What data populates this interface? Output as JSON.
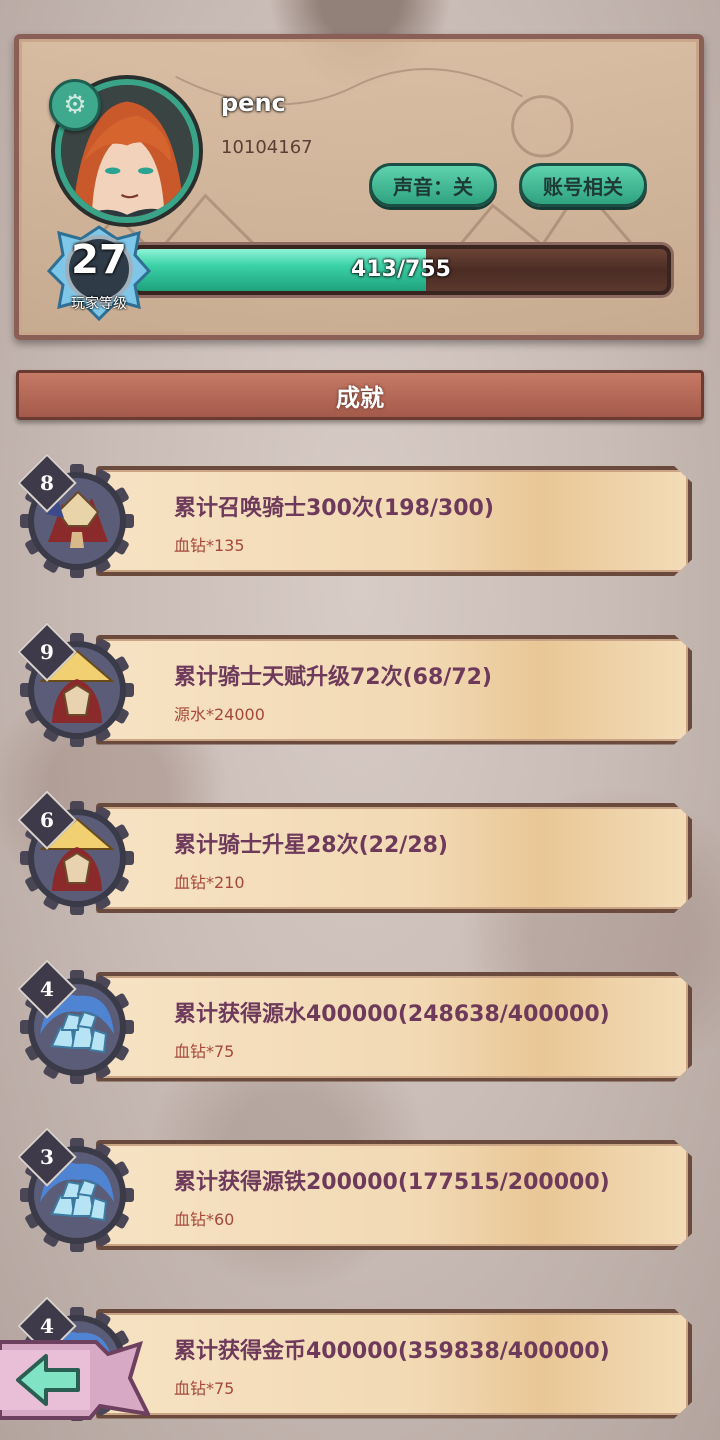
{
  "player": {
    "name": "penc",
    "id": "10104167",
    "level": "27",
    "level_label": "玩家等级",
    "xp_text": "413/755",
    "xp_fraction": 0.547
  },
  "buttons": {
    "sound": "声音：关",
    "account": "账号相关"
  },
  "section_title": "成就",
  "achievements": [
    {
      "num": "8",
      "title": "累计召唤骑士300次(198/300)",
      "reward": "血钻*135",
      "icon": "knight-group-icon"
    },
    {
      "num": "9",
      "title": "累计骑士天赋升级72次(68/72)",
      "reward": "源水*24000",
      "icon": "knight-helmet-icon"
    },
    {
      "num": "6",
      "title": "累计骑士升星28次(22/28)",
      "reward": "血钻*210",
      "icon": "knight-helmet-icon"
    },
    {
      "num": "4",
      "title": "累计获得源水400000(248638/400000)",
      "reward": "血钻*75",
      "icon": "crystal-pile-icon"
    },
    {
      "num": "3",
      "title": "累计获得源铁200000(177515/200000)",
      "reward": "血钻*60",
      "icon": "crystal-pile-icon"
    },
    {
      "num": "4",
      "title": "累计获得金币400000(359838/400000)",
      "reward": "血钻*75",
      "icon": "crystal-pile-icon"
    }
  ],
  "colors": {
    "accent_green": "#3ea98c",
    "title_purple": "#6e3a5b",
    "reward_red": "#a6493b",
    "header_red": "#b5695a"
  }
}
